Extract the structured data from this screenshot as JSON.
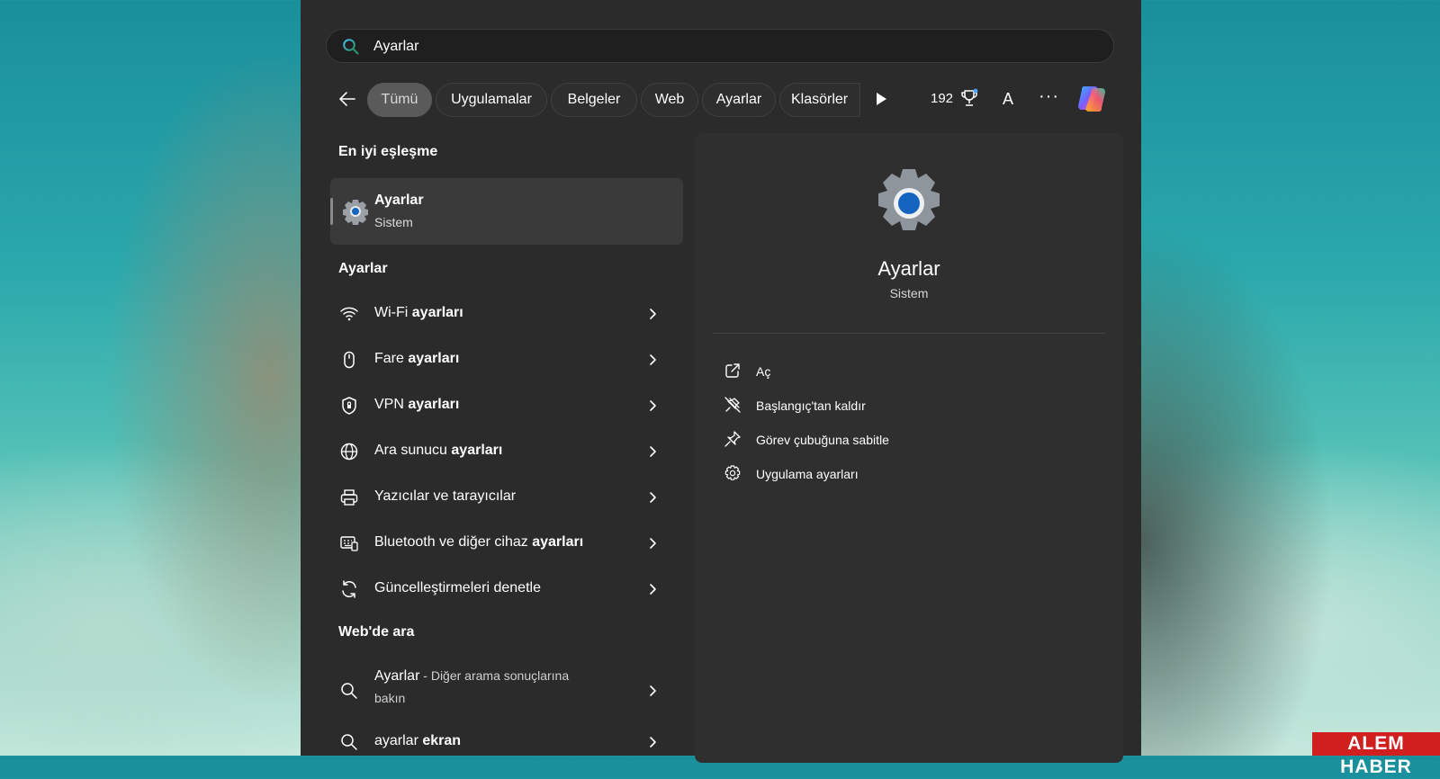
{
  "search": {
    "value": "Ayarlar",
    "placeholder": ""
  },
  "filters": {
    "tabs": [
      {
        "label": "Tümü"
      },
      {
        "label": "Uygulamalar"
      },
      {
        "label": "Belgeler"
      },
      {
        "label": "Web"
      },
      {
        "label": "Ayarlar"
      },
      {
        "label": "Klasörler"
      }
    ],
    "active_index": 0
  },
  "topbar": {
    "points": "192",
    "avatar_letter": "A",
    "more": "···"
  },
  "best_match": {
    "heading": "En iyi eşleşme",
    "title": "Ayarlar",
    "subtitle": "Sistem"
  },
  "settings_section": {
    "heading": "Ayarlar",
    "items": [
      {
        "plain": "Wi-Fi ",
        "bold": "ayarları",
        "icon": "wifi-icon"
      },
      {
        "plain": "Fare ",
        "bold": "ayarları",
        "icon": "mouse-icon"
      },
      {
        "plain": "VPN ",
        "bold": "ayarları",
        "icon": "shield-icon"
      },
      {
        "plain": "Ara sunucu ",
        "bold": "ayarları",
        "icon": "globe-icon"
      },
      {
        "plain": "Yazıcılar ve tarayıcılar",
        "bold": "",
        "icon": "printer-icon"
      },
      {
        "plain": "Bluetooth ve diğer cihaz ",
        "bold": "ayarları",
        "icon": "devices-icon"
      },
      {
        "plain": "Güncelleştirmeleri denetle",
        "bold": "",
        "icon": "refresh-icon"
      }
    ]
  },
  "web_section": {
    "heading": "Web'de ara",
    "items": [
      {
        "plain": "Ayarlar",
        "bold": "",
        "suffix": " - Diğer arama sonuçlarına",
        "suffix2": "bakın"
      },
      {
        "plain": "ayarlar ",
        "bold": "ekran"
      }
    ]
  },
  "preview": {
    "title": "Ayarlar",
    "subtitle": "Sistem",
    "actions": [
      {
        "label": "Aç",
        "icon": "open-external-icon"
      },
      {
        "label": "Başlangıç'tan kaldır",
        "icon": "unpin-icon"
      },
      {
        "label": "Görev çubuğuna sabitle",
        "icon": "pin-icon"
      },
      {
        "label": "Uygulama ayarları",
        "icon": "gear-icon"
      }
    ]
  },
  "watermark": "ALEM HABER",
  "colors": {
    "panel": "#2b2b2b",
    "accent_blue": "#1565c0",
    "brand_red": "#cf1f1f"
  }
}
